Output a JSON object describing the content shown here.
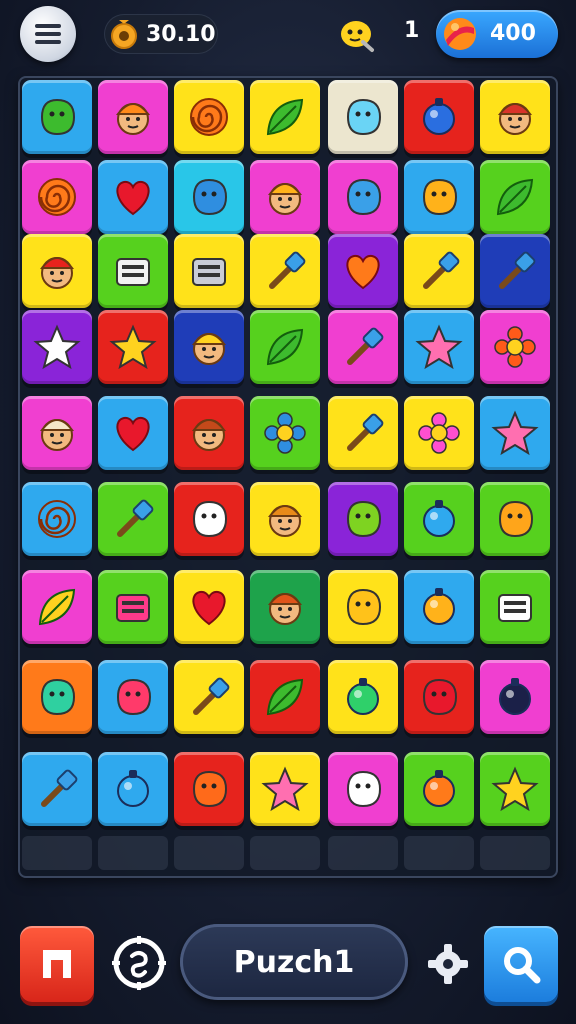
{
  "hud": {
    "coins": "30.10",
    "level": "1",
    "gems": "400"
  },
  "bottom": {
    "title": "Puzch1"
  },
  "colors": {
    "blue": "#2fa9ee",
    "pink": "#f03fd0",
    "yellow": "#ffe21a",
    "red": "#e6231d",
    "cream": "#ece6cf",
    "green": "#56d11e",
    "purple": "#8a24d8",
    "orange": "#ff7a1a",
    "navy": "#1f3db8",
    "darkgreen": "#1ea34b",
    "cyan": "#29c6e8"
  },
  "board": {
    "rows": [
      [
        {
          "color": "blue",
          "icon": "green-blob-icon"
        },
        {
          "color": "pink",
          "icon": "orange-cat-face-icon"
        },
        {
          "color": "yellow",
          "icon": "spiral-icon"
        },
        {
          "color": "yellow",
          "icon": "leaf-arrow-icon"
        },
        {
          "color": "cream",
          "icon": "bubble-icon"
        },
        {
          "color": "red",
          "icon": "blue-note-icon"
        },
        {
          "color": "yellow",
          "icon": "pirate-face-icon"
        }
      ],
      [
        {
          "color": "pink",
          "icon": "spiral-icon"
        },
        {
          "color": "blue",
          "icon": "heart-icon"
        },
        {
          "color": "cyan",
          "icon": "globe-icon"
        },
        {
          "color": "pink",
          "icon": "boy-face-icon"
        },
        {
          "color": "pink",
          "icon": "puzzle-icon"
        },
        {
          "color": "blue",
          "icon": "smiley-icon"
        },
        {
          "color": "green",
          "icon": "palm-tree-icon"
        }
      ],
      [
        {
          "color": "yellow",
          "icon": "mushroom-face-icon"
        },
        {
          "color": "green",
          "icon": "calendar-icon"
        },
        {
          "color": "yellow",
          "icon": "briefcase-icon"
        },
        {
          "color": "yellow",
          "icon": "paintbrush-icon"
        },
        {
          "color": "purple",
          "icon": "orange-heart-icon"
        },
        {
          "color": "yellow",
          "icon": "pencil-icon"
        },
        {
          "color": "navy",
          "icon": "hammer-icon"
        }
      ],
      [
        {
          "color": "purple",
          "icon": "white-star-icon"
        },
        {
          "color": "red",
          "icon": "yellow-star-icon"
        },
        {
          "color": "navy",
          "icon": "blond-face-icon"
        },
        {
          "color": "green",
          "icon": "leaf-icon"
        },
        {
          "color": "pink",
          "icon": "hammer-icon"
        },
        {
          "color": "blue",
          "icon": "pink-star-icon"
        },
        {
          "color": "pink",
          "icon": "flower-icon"
        }
      ],
      [
        {
          "color": "pink",
          "icon": "egg-face-icon"
        },
        {
          "color": "blue",
          "icon": "heart-icon"
        },
        {
          "color": "red",
          "icon": "girl-face-icon"
        },
        {
          "color": "green",
          "icon": "gear-icon"
        },
        {
          "color": "yellow",
          "icon": "shovel-icon"
        },
        {
          "color": "yellow",
          "icon": "pink-flower-icon"
        },
        {
          "color": "blue",
          "icon": "pink-star-icon"
        }
      ],
      [
        {
          "color": "blue",
          "icon": "swirl-icon"
        },
        {
          "color": "green",
          "icon": "rocket-icon"
        },
        {
          "color": "red",
          "icon": "ghost-icon"
        },
        {
          "color": "yellow",
          "icon": "lion-face-icon"
        },
        {
          "color": "purple",
          "icon": "melon-icon"
        },
        {
          "color": "green",
          "icon": "potion-icon"
        },
        {
          "color": "green",
          "icon": "apple-icon"
        }
      ],
      [
        {
          "color": "pink",
          "icon": "wing-icon"
        },
        {
          "color": "green",
          "icon": "hat-icon"
        },
        {
          "color": "yellow",
          "icon": "heart-icon"
        },
        {
          "color": "darkgreen",
          "icon": "cap-face-icon"
        },
        {
          "color": "yellow",
          "icon": "lemon-icon"
        },
        {
          "color": "blue",
          "icon": "coin-leaf-icon"
        },
        {
          "color": "green",
          "icon": "bag-icon"
        }
      ],
      [
        {
          "color": "orange",
          "icon": "fish-icon"
        },
        {
          "color": "blue",
          "icon": "butterfly-icon"
        },
        {
          "color": "yellow",
          "icon": "lipstick-icon"
        },
        {
          "color": "red",
          "icon": "leaf-icon"
        },
        {
          "color": "yellow",
          "icon": "bottle-icon"
        },
        {
          "color": "red",
          "icon": "tomato-icon"
        },
        {
          "color": "pink",
          "icon": "bomb-icon"
        }
      ],
      [
        {
          "color": "blue",
          "icon": "pencil-icon"
        },
        {
          "color": "blue",
          "icon": "potion-icon"
        },
        {
          "color": "red",
          "icon": "strawberry-icon"
        },
        {
          "color": "yellow",
          "icon": "pink-star-icon"
        },
        {
          "color": "pink",
          "icon": "cloud-icon"
        },
        {
          "color": "green",
          "icon": "target-icon"
        },
        {
          "color": "green",
          "icon": "yellow-star-icon"
        }
      ]
    ]
  }
}
